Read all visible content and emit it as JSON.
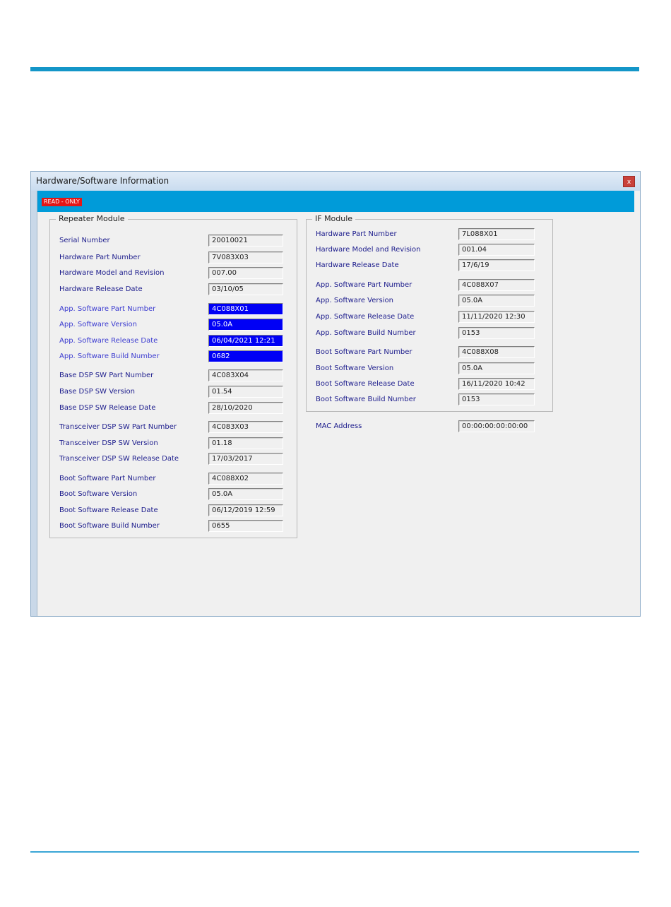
{
  "window": {
    "title": "Hardware/Software Information",
    "close_label": "x",
    "read_only_badge": "READ - ONLY"
  },
  "repeater_module": {
    "legend": "Repeater Module",
    "fields": [
      {
        "label": "Serial Number",
        "value": "20010021"
      },
      {
        "label": "Hardware Part Number",
        "value": "7V083X03"
      },
      {
        "label": "Hardware Model and Revision",
        "value": "007.00"
      },
      {
        "label": "Hardware Release Date",
        "value": "03/10/05"
      },
      {
        "label": "App. Software Part Number",
        "value": "4C088X01"
      },
      {
        "label": "App. Software Version",
        "value": "05.0A"
      },
      {
        "label": "App. Software Release Date",
        "value": "06/04/2021 12:21"
      },
      {
        "label": "App. Software Build Number",
        "value": "0682"
      },
      {
        "label": "Base DSP SW Part Number",
        "value": "4C083X04"
      },
      {
        "label": "Base DSP SW Version",
        "value": "01.54"
      },
      {
        "label": "Base DSP SW Release Date",
        "value": "28/10/2020"
      },
      {
        "label": "Transceiver DSP SW Part Number",
        "value": "4C083X03"
      },
      {
        "label": "Transceiver DSP SW Version",
        "value": "01.18"
      },
      {
        "label": "Transceiver DSP  SW Release Date",
        "value": "17/03/2017"
      },
      {
        "label": "Boot Software Part Number",
        "value": "4C088X02"
      },
      {
        "label": "Boot Software Version",
        "value": "05.0A"
      },
      {
        "label": "Boot Software Release Date",
        "value": "06/12/2019 12:59"
      },
      {
        "label": "Boot Software Build Number",
        "value": "0655"
      }
    ]
  },
  "if_module": {
    "legend": "IF Module",
    "fields": [
      {
        "label": "Hardware Part Number",
        "value": "7L088X01"
      },
      {
        "label": "Hardware Model and Revision",
        "value": "001.04"
      },
      {
        "label": "Hardware Release Date",
        "value": "17/6/19"
      },
      {
        "label": "App. Software Part Number",
        "value": "4C088X07"
      },
      {
        "label": "App. Software Version",
        "value": "05.0A"
      },
      {
        "label": "App. Software Release Date",
        "value": "11/11/2020 12:30"
      },
      {
        "label": "App. Software Build Number",
        "value": "0153"
      },
      {
        "label": "Boot Software Part Number",
        "value": "4C088X08"
      },
      {
        "label": "Boot Software Version",
        "value": "05.0A"
      },
      {
        "label": "Boot Software Release Date",
        "value": "16/11/2020 10:42"
      },
      {
        "label": "Boot Software Build Number",
        "value": "0153"
      }
    ]
  },
  "mac": {
    "label": "MAC Address",
    "value": "00:00:00:00:00:00"
  },
  "colors": {
    "banner": "#009bd9",
    "highlight": "#0000f5",
    "badge": "#e41616",
    "rule": "#1496c8"
  }
}
